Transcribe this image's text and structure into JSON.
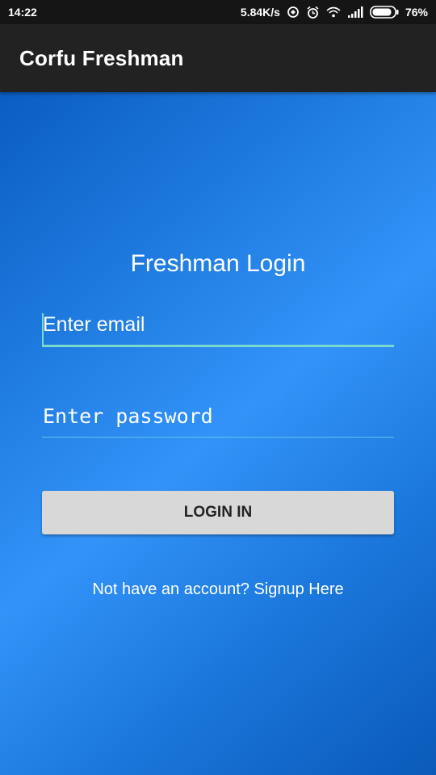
{
  "status_bar": {
    "time": "14:22",
    "speed": "5.84K/s",
    "battery": "76%",
    "icons": [
      "sync-icon",
      "alarm-icon",
      "wifi-icon",
      "signal-icon",
      "battery-icon"
    ]
  },
  "app_bar": {
    "title": "Corfu Freshman"
  },
  "form": {
    "title": "Freshman Login",
    "email_placeholder": "Enter email",
    "password_placeholder": "Enter password",
    "login_label": "LOGIN IN",
    "signup_text": "Not have an account? Signup Here"
  },
  "colors": {
    "app_bar": "#222222",
    "background_light": "#3393f8",
    "background_dark": "#0a5ab9",
    "field_underline": "#7ad9cf",
    "button": "#d8d8d8"
  }
}
